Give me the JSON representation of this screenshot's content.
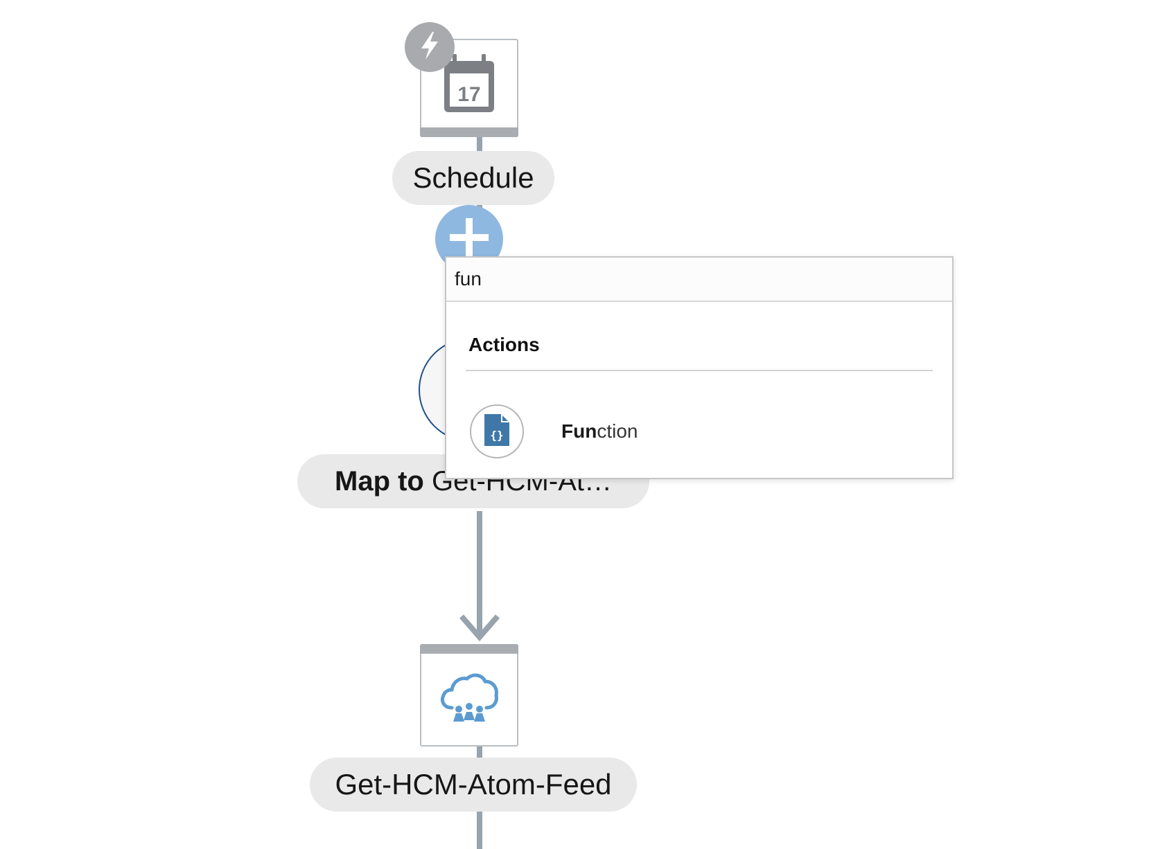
{
  "flow": {
    "trigger": {
      "label": "Schedule",
      "calendar_day": "17",
      "icon": "calendar-icon",
      "badge_icon": "lightning-icon"
    },
    "add_button": {
      "icon": "plus-icon"
    },
    "map_node": {
      "label_bold": "Map to",
      "label_rest": " Get-HCM-At…"
    },
    "invoke_node": {
      "label": "Get-HCM-Atom-Feed",
      "icon": "hcm-cloud-icon"
    }
  },
  "popup": {
    "search_value": "fun",
    "section_title": "Actions",
    "results": [
      {
        "match": "Fun",
        "rest": "ction",
        "icon": "function-file-icon"
      }
    ]
  },
  "colors": {
    "connector": "#97a3ad",
    "add_button": "#8fb8e0",
    "label_pill": "#e9e9e9",
    "function_icon": "#3f78a8",
    "cloud_icon": "#5b9bd0",
    "map_circle_border": "#1e4f8a"
  }
}
